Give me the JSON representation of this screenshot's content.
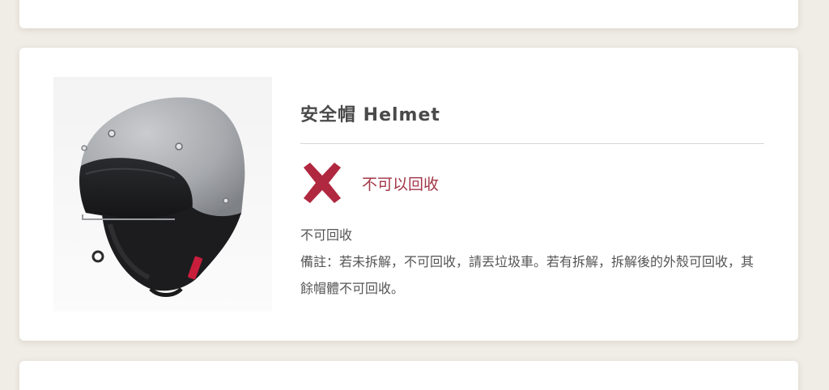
{
  "item": {
    "title": "安全帽 Helmet",
    "image_alt": "helmet",
    "status": {
      "icon": "x-icon",
      "icon_color": "#b0283f",
      "label": "不可以回收"
    },
    "description": {
      "line1": "不可回收",
      "line2": "備註：若未拆解，不可回收，請丟垃圾車。若有拆解，拆解後的外殼可回收，其餘帽體不可回收。"
    }
  },
  "colors": {
    "background": "#f0ede6",
    "card": "#ffffff",
    "status_text": "#a23646",
    "title_text": "#4a4a4a",
    "body_text": "#555555"
  }
}
